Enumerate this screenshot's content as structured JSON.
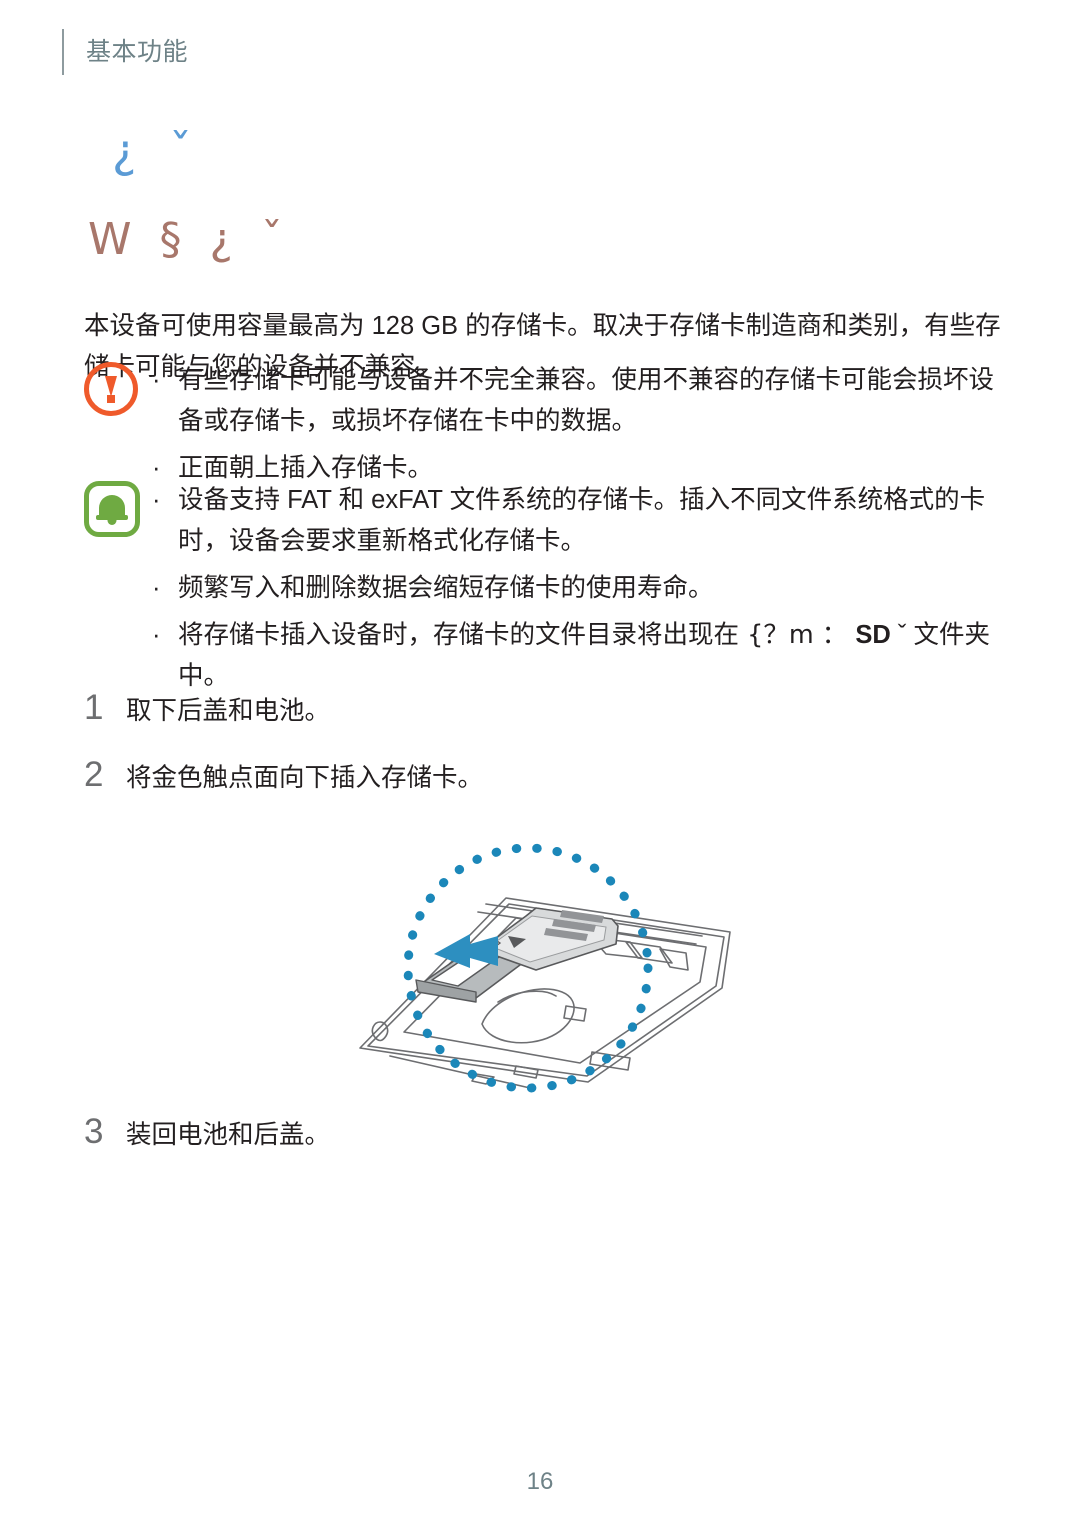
{
  "header": {
    "running_title": "基本功能"
  },
  "titles": {
    "chapter": "¿ ˇ",
    "chapter_color": "#5b9bd5",
    "section": "W § ¿ ˇ",
    "section_color": "#a8776b"
  },
  "intro": {
    "paragraph": "本设备可使用容量最高为 128 GB 的存储卡。取决于存储卡制造商和类别，有些存储卡可能与您的设备并不兼容。"
  },
  "callouts": [
    {
      "icon": "warning-exclamation-icon",
      "icon_color": "#ef5a2b",
      "bullets": [
        {
          "mark": "·",
          "text": "有些存储卡可能与设备并不完全兼容。使用不兼容的存储卡可能会损坏设备或存储卡，或损坏存储在卡中的数据。"
        },
        {
          "mark": "·",
          "text": "正面朝上插入存储卡。"
        }
      ]
    },
    {
      "icon": "bell-note-icon",
      "icon_color": "#6faa42",
      "bullets": [
        {
          "mark": "·",
          "text": "设备支持 FAT 和 exFAT 文件系统的存储卡。插入不同文件系统格式的卡时，设备会要求重新格式化存储卡。"
        },
        {
          "mark": "·",
          "text": "频繁写入和删除数据会缩短存储卡的使用寿命。"
        },
        {
          "mark": "·",
          "text_before": "将存储卡插入设备时，存储卡的文件目录将出现在 {？m    ： ",
          "text_bold": "SD",
          "text_after": " ˇ 文件夹中。"
        }
      ]
    }
  ],
  "steps": [
    {
      "number": "1",
      "text": "取下后盖和电池。"
    },
    {
      "number": "2",
      "text": "将金色触点面向下插入存储卡。"
    },
    {
      "number": "3",
      "text": "装回电池和后盖。"
    }
  ],
  "figure": {
    "name": "memory-card-insertion-diagram",
    "highlight_color": "#1b87b9",
    "arrow_color": "#2d8fc0",
    "card_fill": "#b7bbbd",
    "outline_color": "#6d6e71",
    "description": "手机后盖内部，虚线圆圈标示存储卡插槽，蓝色箭头指示插入方向"
  },
  "footer": {
    "page_number": "16"
  }
}
